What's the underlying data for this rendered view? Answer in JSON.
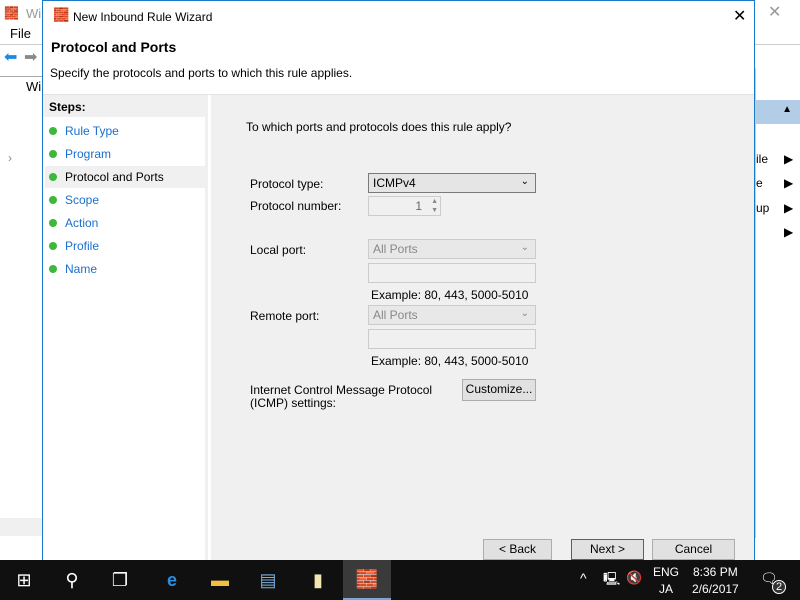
{
  "background_window": {
    "title": "Wi",
    "menu_file": "File",
    "tree_root": "Wi",
    "actions": [
      "ile",
      "e",
      "up",
      ""
    ]
  },
  "dialog": {
    "title": "New Inbound Rule Wizard",
    "header_title": "Protocol and Ports",
    "header_subtitle": "Specify the protocols and ports to which this rule applies.",
    "steps_label": "Steps:",
    "steps": [
      "Rule Type",
      "Program",
      "Protocol and Ports",
      "Scope",
      "Action",
      "Profile",
      "Name"
    ],
    "selected_step": "Protocol and Ports",
    "question": "To which ports and protocols does this rule apply?",
    "protocol_type_label": "Protocol type:",
    "protocol_type_value": "ICMPv4",
    "protocol_number_label": "Protocol number:",
    "protocol_number_value": "1",
    "local_port_label": "Local port:",
    "local_port_value": "All Ports",
    "local_example": "Example: 80, 443, 5000-5010",
    "remote_port_label": "Remote port:",
    "remote_port_value": "All Ports",
    "remote_example": "Example: 80, 443, 5000-5010",
    "icmp_label_1": "Internet Control Message Protocol",
    "icmp_label_2": "(ICMP) settings:",
    "customize": "Customize...",
    "back": "< Back",
    "next": "Next >",
    "cancel": "Cancel"
  },
  "taskbar": {
    "lang1": "ENG",
    "lang2": "JA",
    "time": "8:36 PM",
    "date": "2/6/2017",
    "notifications": "2"
  }
}
